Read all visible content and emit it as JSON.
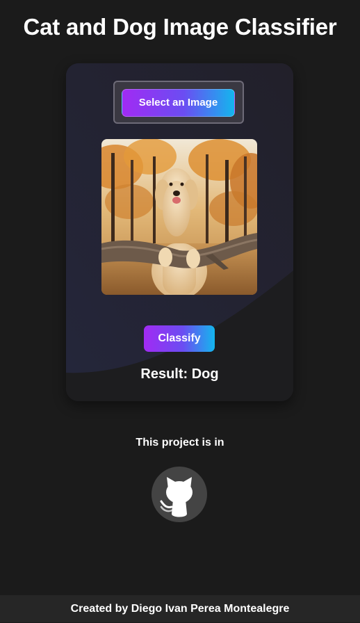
{
  "page": {
    "title": "Cat and Dog Image Classifier"
  },
  "classifier": {
    "select_label": "Select an Image",
    "preview_subject": "golden retriever leaning on a log in an autumn forest",
    "classify_label": "Classify",
    "result_text": "Result: Dog"
  },
  "project": {
    "text": "This project is in",
    "icon": "github-icon"
  },
  "footer": {
    "credit": "Created by Diego Ivan Perea Montealegre"
  },
  "colors": {
    "background": "#1b1b1b",
    "card": "#23202c",
    "button_gradient_start": "#a12bf3",
    "button_gradient_end": "#14b6ee",
    "footer": "#262626",
    "github_circle": "#444444"
  }
}
